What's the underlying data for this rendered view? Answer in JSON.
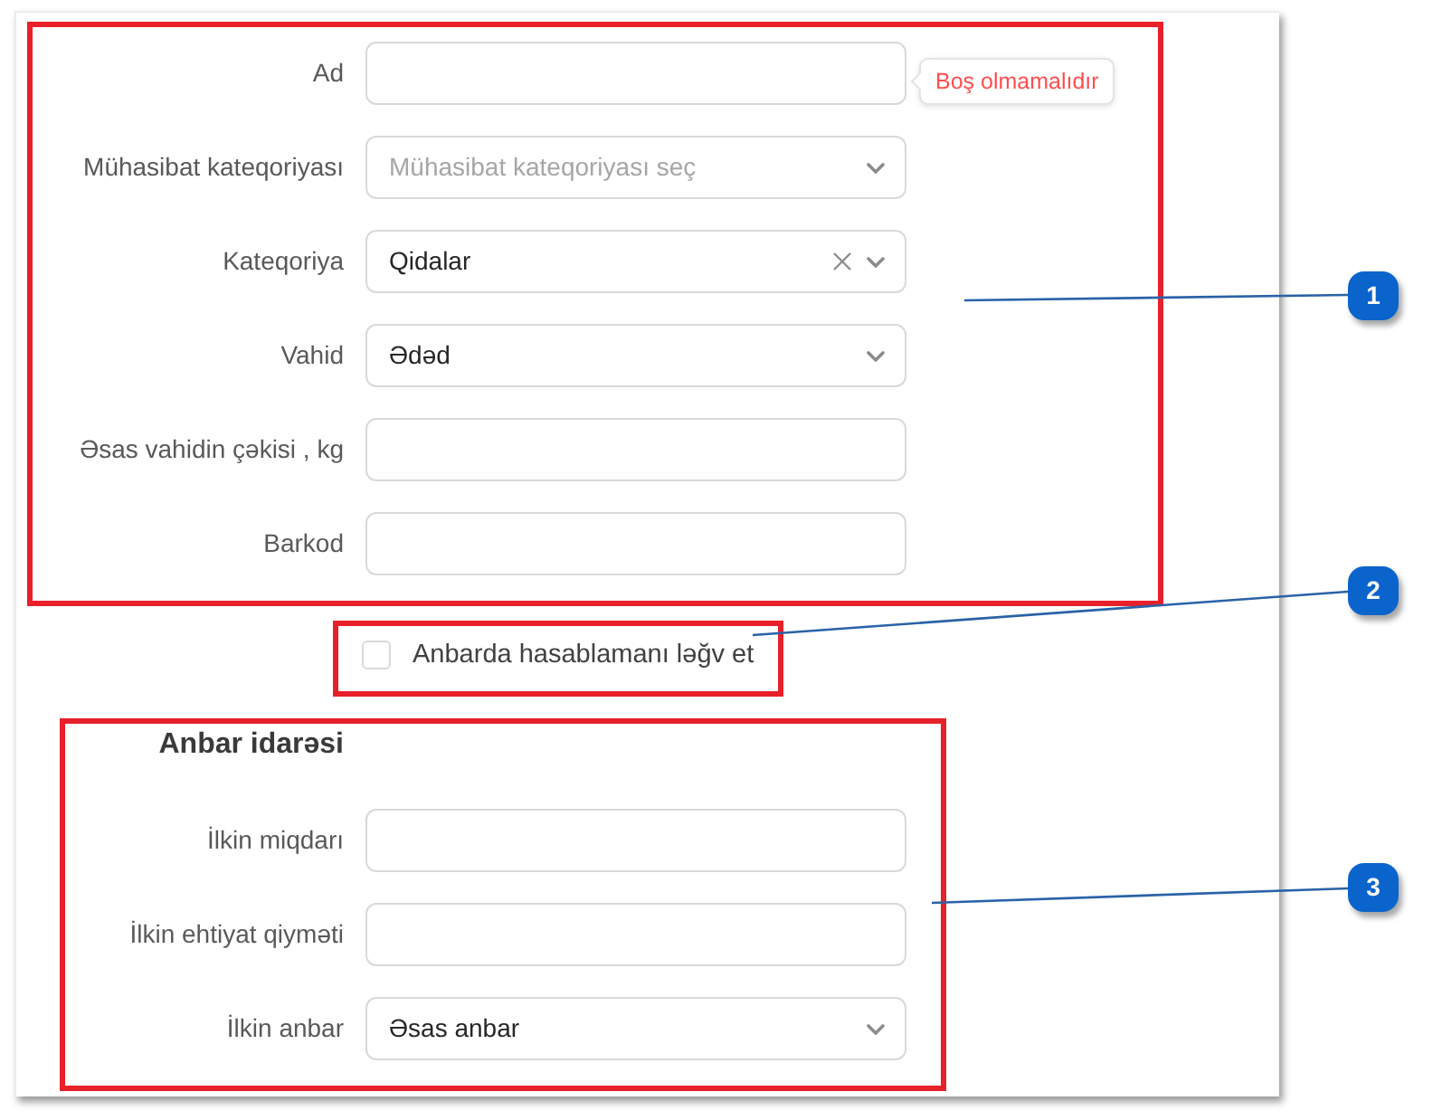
{
  "form": {
    "sections": [
      {
        "kind": "fields",
        "fields": [
          {
            "label": "Ad",
            "kind": "input",
            "error": "Boş olmamalıdır"
          },
          {
            "label": "Mühasibat kateqoriyası",
            "kind": "select",
            "placeholder": "Mühasibat kateqoriyası seç"
          },
          {
            "label": "Kateqoriya",
            "kind": "select",
            "value": "Qidalar",
            "clearable": true
          },
          {
            "label": "Vahid",
            "kind": "select",
            "value": "Ədəd"
          },
          {
            "label": "Əsas vahidin çəkisi , kg",
            "kind": "input"
          },
          {
            "label": "Barkod",
            "kind": "input"
          }
        ]
      },
      {
        "kind": "checkbox",
        "label": "Anbarda hasablamanı ləğv et",
        "checked": false
      },
      {
        "kind": "fields",
        "title": "Anbar idarəsi",
        "fields": [
          {
            "label": "İlkin miqdarı",
            "kind": "input"
          },
          {
            "label": "İlkin ehtiyat qiyməti",
            "kind": "input"
          },
          {
            "label": "İlkin anbar",
            "kind": "select",
            "value": "Əsas anbar"
          }
        ]
      }
    ]
  },
  "callouts": [
    {
      "number": "1"
    },
    {
      "number": "2"
    },
    {
      "number": "3"
    }
  ]
}
